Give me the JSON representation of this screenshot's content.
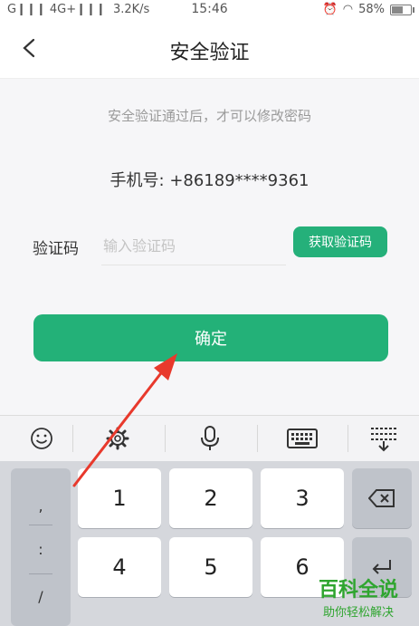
{
  "status_bar": {
    "signal": "G❙❙❙ 4G+❙❙❙",
    "speed": "3.2K/s",
    "time": "15:46",
    "battery": "58%",
    "battery_level": 0.58
  },
  "header": {
    "title": "安全验证"
  },
  "content": {
    "hint": "安全验证通过后，才可以修改密码",
    "phone": "手机号: +86189****9361",
    "code_label": "验证码",
    "code_placeholder": "输入验证码",
    "get_code_label": "获取验证码",
    "confirm_label": "确定"
  },
  "keyboard": {
    "symbols": [
      ",",
      ":",
      "/"
    ],
    "keys": [
      "1",
      "2",
      "3",
      "4",
      "5",
      "6"
    ]
  },
  "watermark": {
    "main": "百科全说",
    "sub": "助你轻松解决"
  },
  "colors": {
    "accent": "#23b178",
    "annotation": "#e8392c"
  }
}
